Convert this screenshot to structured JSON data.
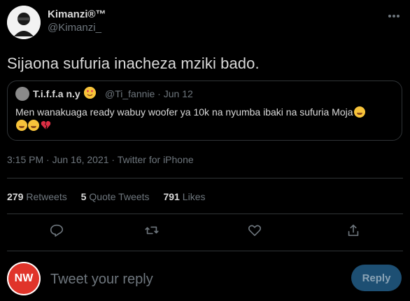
{
  "author": {
    "name": "Kimanzi®™",
    "handle": "@Kimanzi_"
  },
  "tweet": {
    "text": "Sijaona sufuria inacheza mziki bado.",
    "timestamp": "3:15 PM · Jun 16, 2021 · Twitter for iPhone"
  },
  "quoted": {
    "name": "T.i.f.f.a n.y",
    "meta": "@Ti_fannie · Jun 12",
    "text": "Men wanakuaga ready wabuy woofer ya 10k na nyumba ibaki na sufuria Moja"
  },
  "stats": {
    "retweets_count": "279",
    "retweets_label": "Retweets",
    "quotes_count": "5",
    "quotes_label": "Quote Tweets",
    "likes_count": "791",
    "likes_label": "Likes"
  },
  "reply": {
    "avatar_initials": "NW",
    "placeholder": "Tweet your reply",
    "button_label": "Reply"
  },
  "icons": [
    "reply-icon",
    "retweet-icon",
    "like-icon",
    "share-icon",
    "more-icon"
  ],
  "colors": {
    "background": "#000000",
    "text": "#d9d9d9",
    "muted": "#6e767d",
    "divider": "#2f3336",
    "reply_button": "#1d4f73"
  }
}
